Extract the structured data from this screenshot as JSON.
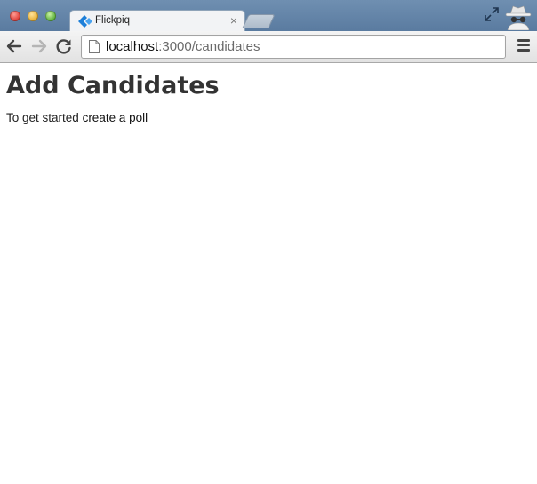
{
  "browser": {
    "tab": {
      "title": "Flickpiq",
      "close_symbol": "×"
    },
    "url": {
      "host": "localhost",
      "rest": ":3000/candidates"
    }
  },
  "page": {
    "heading": "Add Candidates",
    "intro_text": "To get started ",
    "link_text": "create a poll"
  },
  "icons": {
    "favicon": "flickpiq-diamond-icon",
    "back": "arrow-left-icon",
    "forward": "arrow-right-icon",
    "reload": "reload-icon",
    "page": "page-icon",
    "menu": "hamburger-menu-icon",
    "fullscreen": "fullscreen-icon",
    "incognito": "incognito-icon"
  },
  "colors": {
    "titlebar": "#5a7ba0",
    "favicon": "#1e7fd8"
  }
}
